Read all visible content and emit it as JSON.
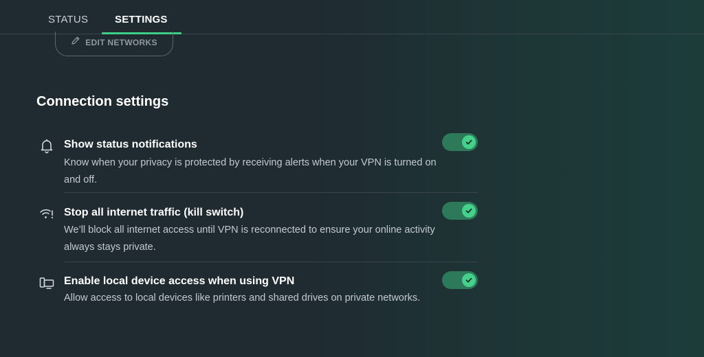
{
  "tabs": {
    "status_label": "STATUS",
    "settings_label": "SETTINGS",
    "active": "SETTINGS"
  },
  "edit_networks": {
    "label": "EDIT NETWORKS",
    "icon": "pencil-icon"
  },
  "connection_settings": {
    "title": "Connection settings",
    "items": [
      {
        "icon": "bell-icon",
        "title": "Show status notifications",
        "description": "Know when your privacy is protected by receiving alerts when your VPN is turned on and off.",
        "enabled": true
      },
      {
        "icon": "wifi-off-icon",
        "title": "Stop all internet traffic (kill switch)",
        "description": "We’ll block all internet access until VPN is reconnected to ensure your online activity always stays private.",
        "enabled": true
      },
      {
        "icon": "devices-icon",
        "title": "Enable local device access when using VPN",
        "description": "Allow access to local devices like printers and shared drives on private networks.",
        "enabled": true
      }
    ]
  },
  "colors": {
    "accent": "#3fcf86",
    "toggle_track": "#2d7a5a",
    "toggle_knob": "#45d18c"
  }
}
